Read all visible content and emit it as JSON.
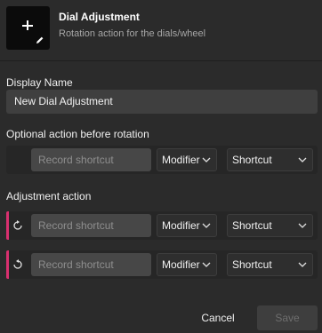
{
  "header": {
    "title": "Dial Adjustment",
    "subtitle": "Rotation action for the dials/wheel",
    "icon": "plus-icon",
    "edit_icon": "pencil-icon"
  },
  "display_name": {
    "label": "Display Name",
    "value": "New Dial Adjustment"
  },
  "before_rotation": {
    "label": "Optional action before rotation",
    "shortcut_placeholder": "Record shortcut",
    "modifier": "Modifier",
    "shortcut": "Shortcut"
  },
  "adjustment": {
    "label": "Adjustment action",
    "rows": [
      {
        "icon": "rotate-clockwise-icon",
        "shortcut_placeholder": "Record shortcut",
        "modifier": "Modifier",
        "shortcut": "Shortcut"
      },
      {
        "icon": "rotate-counterclockwise-icon",
        "shortcut_placeholder": "Record shortcut",
        "modifier": "Modifier",
        "shortcut": "Shortcut"
      }
    ]
  },
  "footer": {
    "cancel_label": "Cancel",
    "save_label": "Save"
  },
  "colors": {
    "accent": "#d9306f",
    "background": "#2b2b2b"
  }
}
